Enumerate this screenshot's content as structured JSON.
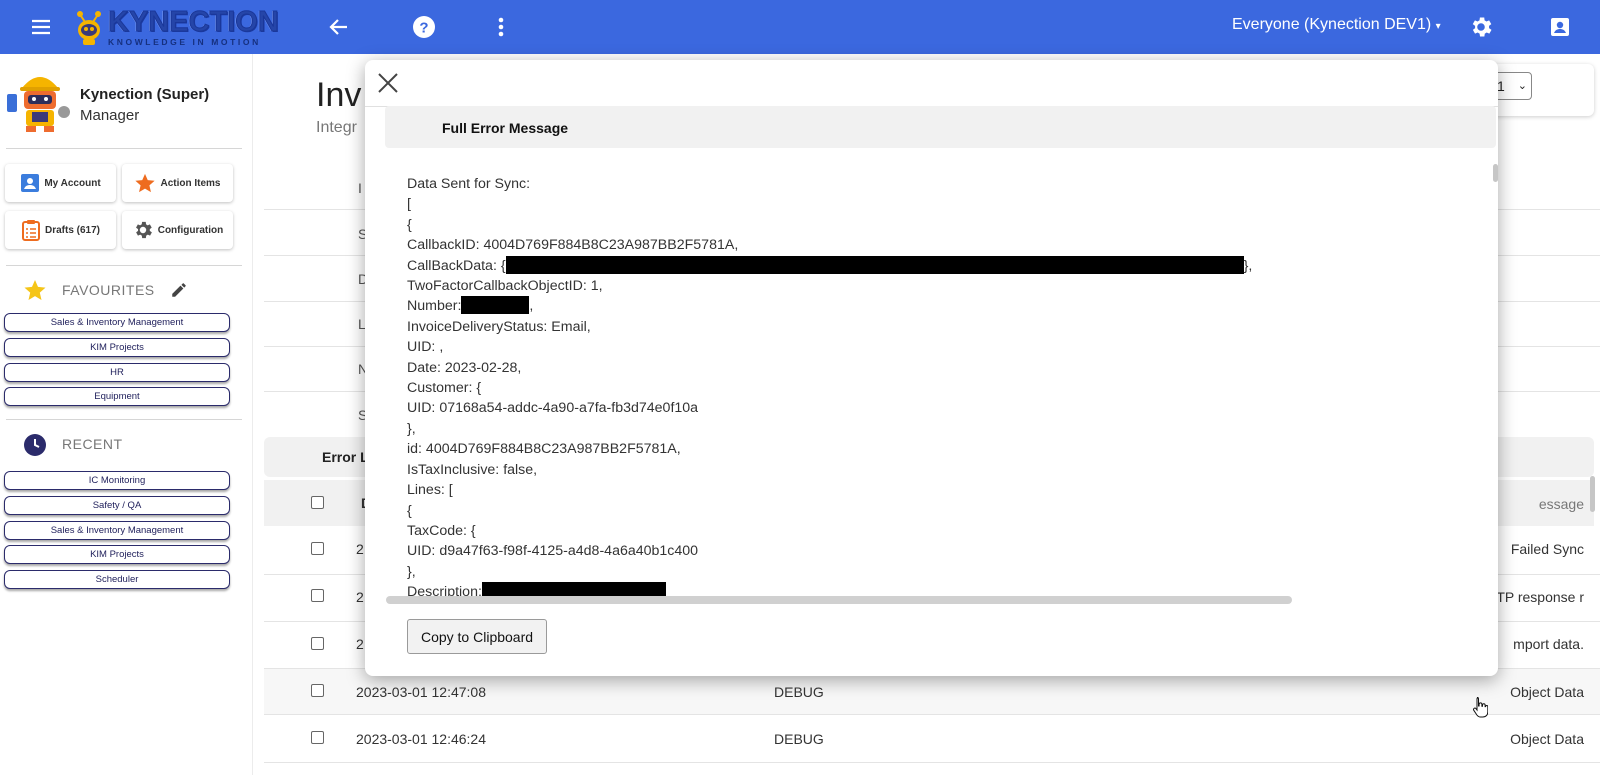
{
  "topbar": {
    "logo_text": "KYNECTION",
    "logo_tagline": "KNOWLEDGE IN MOTION",
    "scope_label": "Everyone (Kynection DEV1)",
    "icons": [
      "menu-icon",
      "back-arrow-icon",
      "help-icon",
      "more-vert-icon",
      "gear-icon",
      "account-box-icon"
    ],
    "accent_color": "#3b68df"
  },
  "sidebar": {
    "profile_name": "Kynection (Super)",
    "profile_role": "Manager",
    "tiles": [
      {
        "label": "My Account",
        "icon": "account-icon"
      },
      {
        "label": "Action Items",
        "icon": "star-icon"
      },
      {
        "label": "Drafts (617)",
        "icon": "clipboard-icon"
      },
      {
        "label": "Configuration",
        "icon": "gear-icon"
      }
    ],
    "favourites_title": "FAVOURITES",
    "favourites": [
      "Sales & Inventory Management",
      "KIM Projects",
      "HR",
      "Equipment"
    ],
    "recent_title": "RECENT",
    "recent": [
      "IC Monitoring",
      "Safety / QA",
      "Sales & Inventory Management",
      "KIM Projects",
      "Scheduler"
    ]
  },
  "background": {
    "title": "Inv",
    "subtitle": "Integr",
    "select_value": "1",
    "row_letters": [
      "I",
      "S",
      "D",
      "L",
      "N",
      "S"
    ],
    "error_card_title": "Error L",
    "header_col1": "D",
    "header_message": "essage",
    "rows": [
      {
        "date": "2",
        "level": "",
        "message": "Failed Sync"
      },
      {
        "date": "2",
        "level": "",
        "message": "TP response r"
      },
      {
        "date": "2",
        "level": "",
        "message": "mport data."
      },
      {
        "date": "2023-03-01 12:47:08",
        "level": "DEBUG",
        "message": "Object Data"
      },
      {
        "date": "2023-03-01 12:46:24",
        "level": "DEBUG",
        "message": "Object Data"
      }
    ]
  },
  "modal": {
    "header_title": "Full Error Message",
    "lines": {
      "l1": "Data Sent for Sync:",
      "l2": "[",
      "l3": "{",
      "l4": "CallbackID: 4004D769F884B8C23A987BB2F5781A,",
      "l5a": "CallBackData: {",
      "l5b": "},",
      "l6": "TwoFactorCallbackObjectID: 1,",
      "l7a": "Number:",
      "l7b": ",",
      "l8": "InvoiceDeliveryStatus: Email,",
      "l9": "UID: ,",
      "l10": "Date: 2023-02-28,",
      "l11": "Customer: {",
      "l12": "UID: 07168a54-addc-4a90-a7fa-fb3d74e0f10a",
      "l13": "},",
      "l14": "id: 4004D769F884B8C23A987BB2F5781A,",
      "l15": "IsTaxInclusive: false,",
      "l16": "Lines: [",
      "l17": "{",
      "l18": "TaxCode: {",
      "l19": "UID: d9a47f63-f98f-4125-a4d8-4a6a40b1c400",
      "l20": "},",
      "l21": "Description:"
    },
    "copy_button": "Copy to Clipboard"
  }
}
